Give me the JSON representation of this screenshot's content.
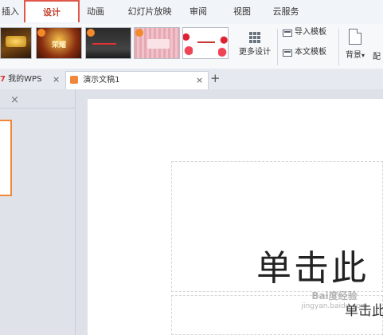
{
  "menu": {
    "tabs": [
      {
        "label": "插入",
        "active": false
      },
      {
        "label": "设计",
        "active": true
      },
      {
        "label": "动画",
        "active": false
      },
      {
        "label": "幻灯片放映",
        "active": false
      },
      {
        "label": "审阅",
        "active": false
      },
      {
        "label": "视图",
        "active": false
      },
      {
        "label": "云服务",
        "active": false
      }
    ]
  },
  "ribbon": {
    "thumbnails": [
      {
        "name": "design-thumb-1",
        "text": ""
      },
      {
        "name": "design-thumb-2",
        "text": "荣耀"
      },
      {
        "name": "design-thumb-3",
        "text": ""
      },
      {
        "name": "design-thumb-4",
        "text": ""
      },
      {
        "name": "design-thumb-5",
        "text": ""
      }
    ],
    "more_designs": "更多设计",
    "import_template": "导入模板",
    "this_template": "本文模板",
    "background": "背景",
    "background_arrow": "▾",
    "cut_off_label": "配"
  },
  "doc_tabs": {
    "my_wps": "我的WPS",
    "presentation": "演示文稿1",
    "close_glyph": "×",
    "add_glyph": "+"
  },
  "slide": {
    "title_placeholder": "单击此",
    "subtitle_placeholder": "单击此"
  },
  "watermark": {
    "text": "Bai度经验",
    "url": "jingyan.baidu.com"
  },
  "colors": {
    "accent_red": "#e0574a",
    "selection_orange": "#f0883b"
  }
}
